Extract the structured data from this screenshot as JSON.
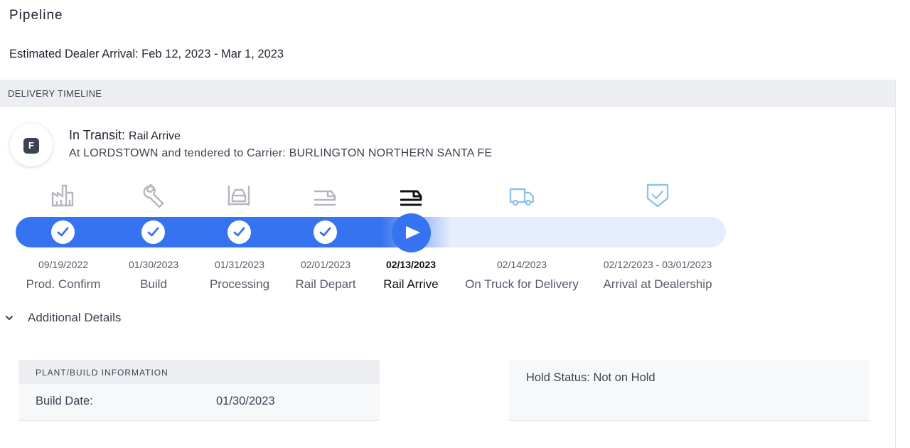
{
  "page": {
    "title": "Pipeline",
    "estimated_arrival": "Estimated Dealer Arrival: Feb 12, 2023 - Mar 1, 2023"
  },
  "timeline": {
    "section_title": "DELIVERY TIMELINE",
    "avatar_letter": "F",
    "status_label": "In Transit:",
    "status_value": "Rail Arrive",
    "status_detail": "At LORDSTOWN and tendered to Carrier: BURLINGTON NORTHERN SANTA FE",
    "progress_completed_stages": 4,
    "current_stage_index": 4,
    "stages": [
      {
        "date": "09/19/2022",
        "label": "Prod. Confirm",
        "icon": "factory-icon",
        "state": "done"
      },
      {
        "date": "01/30/2023",
        "label": "Build",
        "icon": "wrench-icon",
        "state": "done"
      },
      {
        "date": "01/31/2023",
        "label": "Processing",
        "icon": "car-lift-icon",
        "state": "done"
      },
      {
        "date": "02/01/2023",
        "label": "Rail Depart",
        "icon": "train-icon",
        "state": "done"
      },
      {
        "date": "02/13/2023",
        "label": "Rail Arrive",
        "icon": "train-icon",
        "state": "current"
      },
      {
        "date": "02/14/2023",
        "label": "On Truck for Delivery",
        "icon": "truck-icon",
        "state": "upcoming"
      },
      {
        "date": "02/12/2023 - 03/01/2023",
        "label": "Arrival at Dealership",
        "icon": "shield-check-icon",
        "state": "upcoming"
      }
    ],
    "colors": {
      "accent": "#3673f0",
      "track_background": "#e6edfc",
      "done_icon": "#b4b7bd",
      "upcoming_icon": "#8ec3ea",
      "current_icon": "#111111"
    }
  },
  "details": {
    "toggle_label": "Additional Details",
    "plant_header": "PLANT/BUILD INFORMATION",
    "build_date_label": "Build Date:",
    "build_date_value": "01/30/2023",
    "hold_status": "Hold Status: Not on Hold"
  }
}
